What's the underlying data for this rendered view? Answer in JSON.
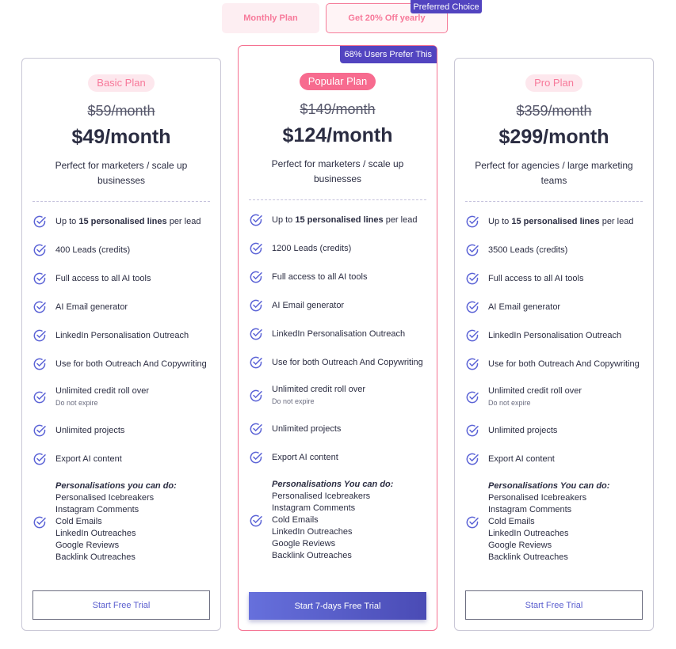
{
  "toggle": {
    "monthly": "Monthly Plan",
    "yearly": "Get 20% Off yearly",
    "preferred": "Preferred Choice"
  },
  "colors": {
    "accent": "#5244c0",
    "pink": "#f76b8f"
  },
  "plans": [
    {
      "badge": "Basic Plan",
      "old_price": "$59/month",
      "price": "$49/month",
      "desc": "Perfect for marketers / scale up businesses",
      "leads": "400 Leads (credits)",
      "button": "Start Free Trial",
      "ptitle": "Personalisations you can do:"
    },
    {
      "badge": "Popular Plan",
      "ribbon": "68% Users Prefer This",
      "old_price": "$149/month",
      "price": "$124/month",
      "desc": "Perfect for marketers / scale up businesses",
      "leads": "1200 Leads (credits)",
      "button": "Start 7-days Free Trial",
      "ptitle": "Personalisations You can do:"
    },
    {
      "badge": "Pro Plan",
      "old_price": "$359/month",
      "price": "$299/month",
      "desc": "Perfect for agencies / large marketing teams",
      "leads": "3500 Leads (credits)",
      "button": "Start Free Trial",
      "ptitle": "Personalisations You can do:"
    }
  ],
  "features": {
    "lines_pre": "Up to ",
    "lines_bold": "15 personalised lines",
    "lines_post": " per lead",
    "ai_tools": "Full access to all AI tools",
    "email": "AI Email generator",
    "linkedin": "LinkedIn Personalisation Outreach",
    "both": "Use for both Outreach And Copywriting",
    "rollover": "Unlimited credit roll over",
    "rollover_sub": "Do not expire",
    "projects": "Unlimited projects",
    "export": "Export AI content",
    "personalisations": [
      "Personalised Icebreakers",
      "Instagram Comments",
      "Cold Emails",
      "LinkedIn Outreaches",
      "Google Reviews",
      "Backlink Outreaches"
    ]
  }
}
